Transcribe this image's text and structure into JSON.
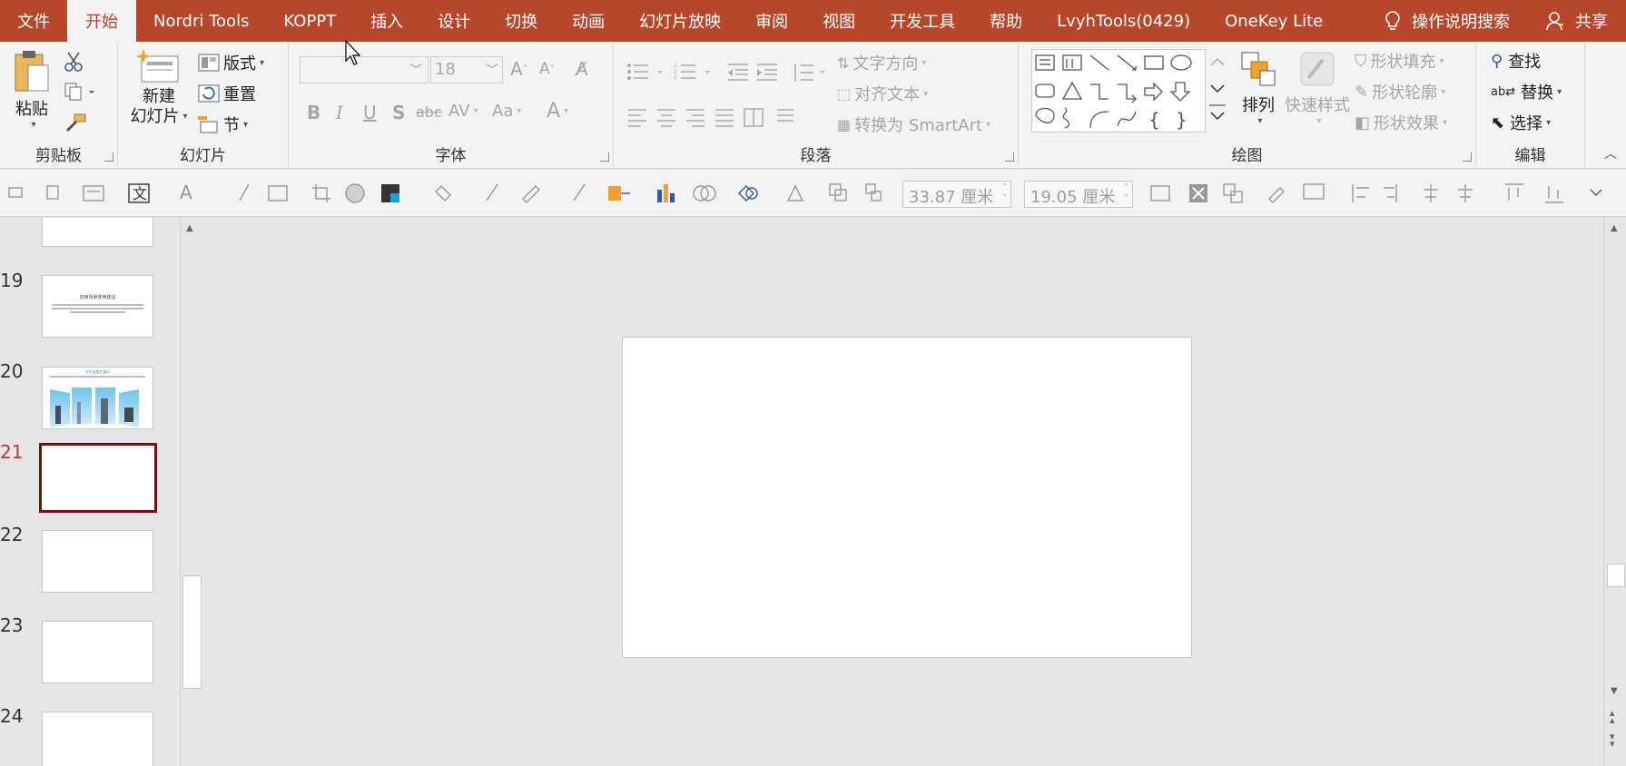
{
  "menubar": {
    "tabs": [
      "文件",
      "开始",
      "Nordri Tools",
      "KOPPT",
      "插入",
      "设计",
      "切换",
      "动画",
      "幻灯片放映",
      "审阅",
      "视图",
      "开发工具",
      "帮助",
      "LvyhTools(0429)",
      "OneKey Lite"
    ],
    "active_tab": "开始",
    "search_label": "操作说明搜索",
    "share_label": "共享"
  },
  "ribbon": {
    "clipboard": {
      "label": "剪贴板",
      "paste": "粘贴"
    },
    "slides": {
      "label": "幻灯片",
      "new_slide_line1": "新建",
      "new_slide_line2": "幻灯片",
      "layout": "版式",
      "reset": "重置",
      "section": "节"
    },
    "font": {
      "label": "字体",
      "font_size": "18"
    },
    "paragraph": {
      "label": "段落",
      "text_direction": "文字方向",
      "align_text": "对齐文本",
      "convert_smartart": "转换为 SmartArt"
    },
    "drawing": {
      "label": "绘图",
      "arrange": "排列",
      "quick_styles": "快速样式",
      "shape_fill": "形状填充",
      "shape_outline": "形状轮廓",
      "shape_effects": "形状效果"
    },
    "editing": {
      "label": "编辑",
      "find": "查找",
      "replace": "替换",
      "select": "选择"
    }
  },
  "toolbar2": {
    "width_value": "33.87 厘米",
    "height_value": "19.05 厘米"
  },
  "thumbnails": {
    "slides": [
      {
        "num": "19",
        "title": "应用场景使用建议"
      },
      {
        "num": "20",
        "title": "卡片式图片展示"
      },
      {
        "num": "21"
      },
      {
        "num": "22"
      },
      {
        "num": "23"
      },
      {
        "num": "24"
      }
    ],
    "current": "21"
  },
  "colors": {
    "accent": "#b7472a",
    "selected_border": "#7a0f0f"
  }
}
